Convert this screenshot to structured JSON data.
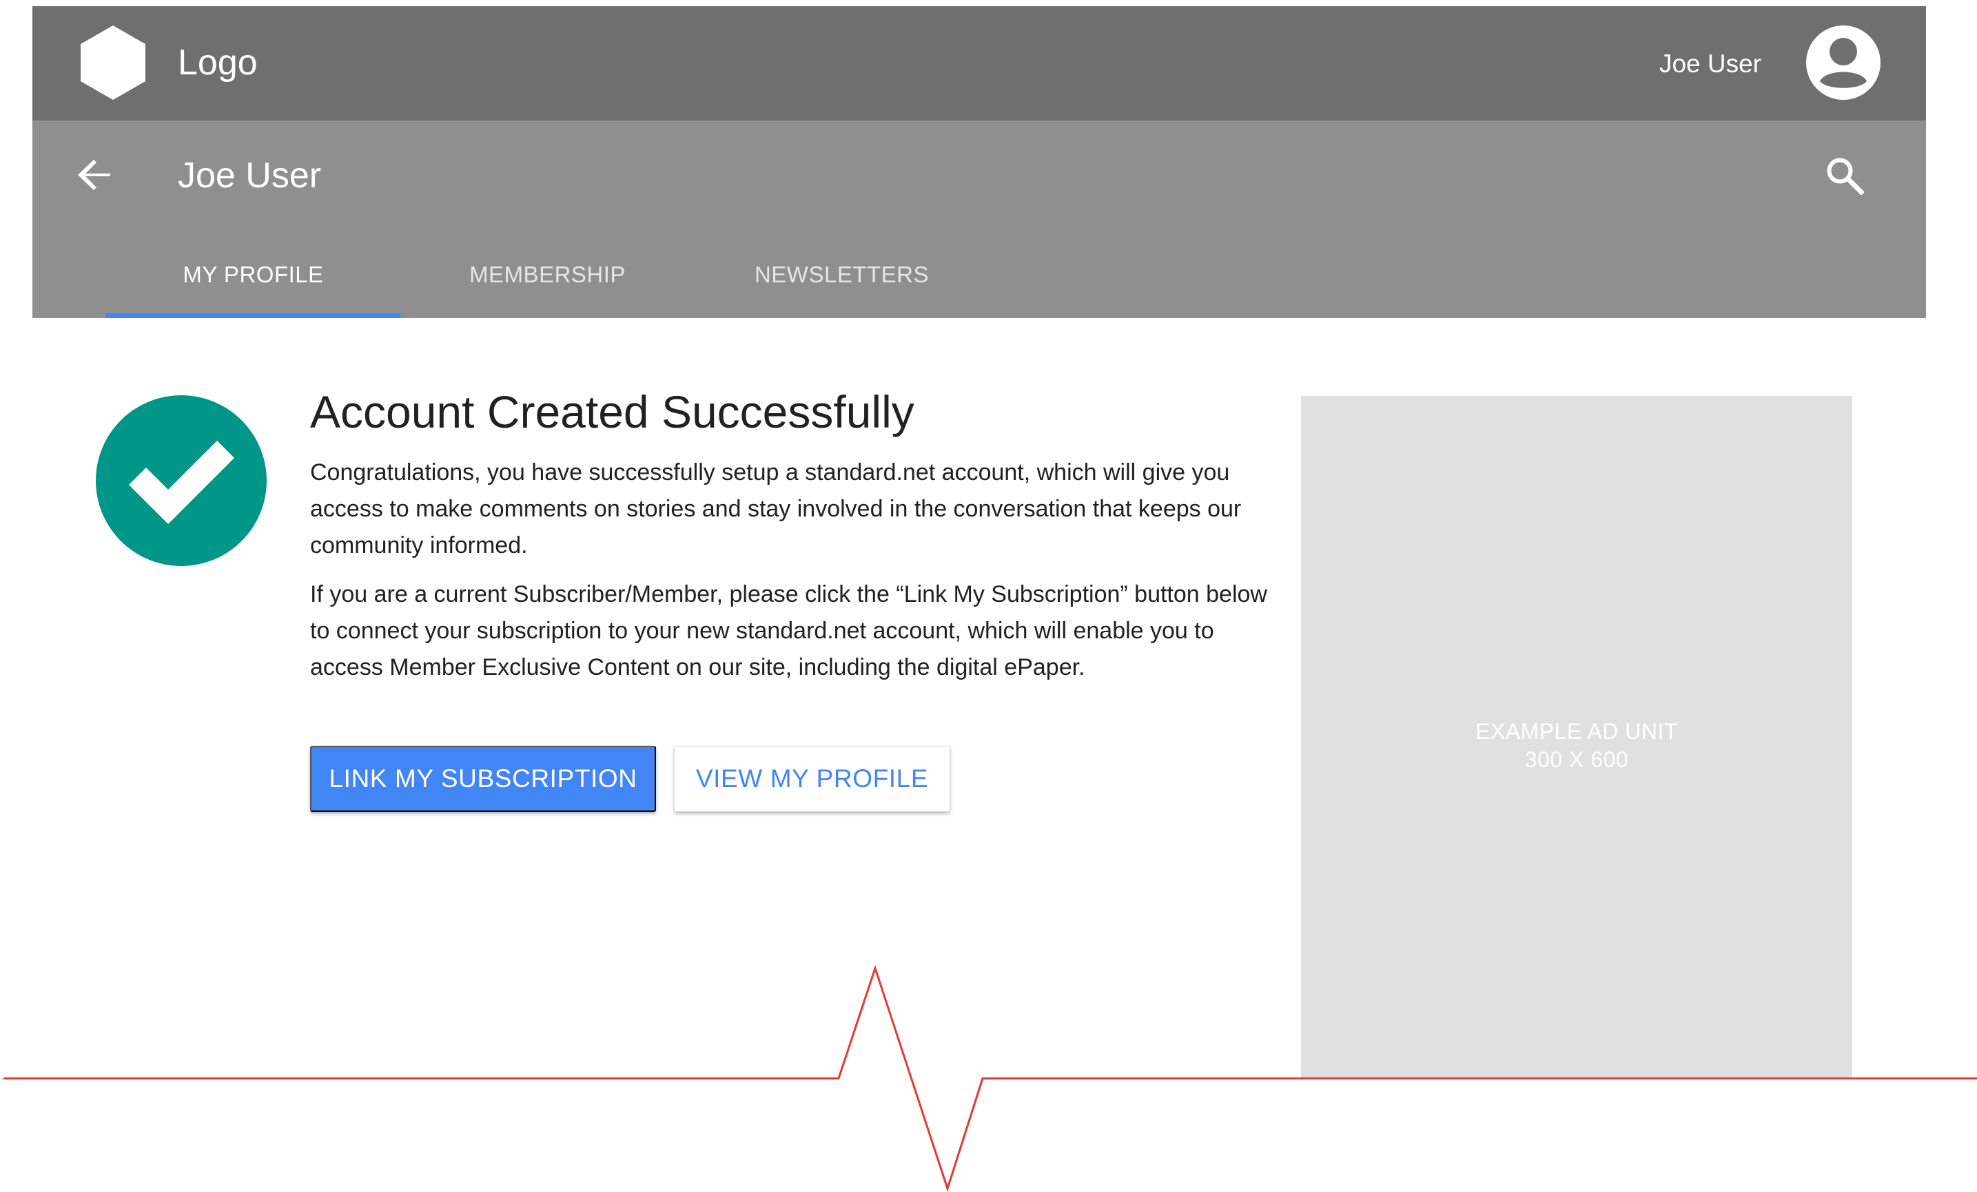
{
  "header": {
    "logo_text": "Logo",
    "logo_icon": "hexagon-logo-icon",
    "user_name": "Joe User",
    "avatar_icon": "account-circle-icon"
  },
  "subheader": {
    "back_icon": "arrow-back-icon",
    "title": "Joe User",
    "search_icon": "search-icon",
    "tabs": [
      {
        "label": "MY PROFILE",
        "active": true
      },
      {
        "label": "MEMBERSHIP",
        "active": false
      },
      {
        "label": "NEWSLETTERS",
        "active": false
      }
    ]
  },
  "main": {
    "status_icon": "check-circle-icon",
    "headline": "Account Created Successfully",
    "paragraph1": "Congratulations, you have successfully setup a standard.net account, which will give you access to make comments on stories and stay involved in the conversation that keeps our community informed.",
    "paragraph2": "If you are a current Subscriber/Member, please click the “Link My Subscription” button below to connect your subscription to your new standard.net account, which will enable you to access Member Exclusive Content on our site, including the digital ePaper.",
    "primary_button": "LINK MY SUBSCRIPTION",
    "secondary_button": "VIEW MY PROFILE"
  },
  "ad": {
    "line1": "EXAMPLE AD UNIT",
    "line2": "300 X 600"
  },
  "colors": {
    "topbar": "#6f6f6f",
    "subbar": "#8f8f8f",
    "accent": "#4285f4",
    "success": "#009688",
    "ad_background": "#e0e0e0",
    "annotation_line": "#e53935"
  }
}
